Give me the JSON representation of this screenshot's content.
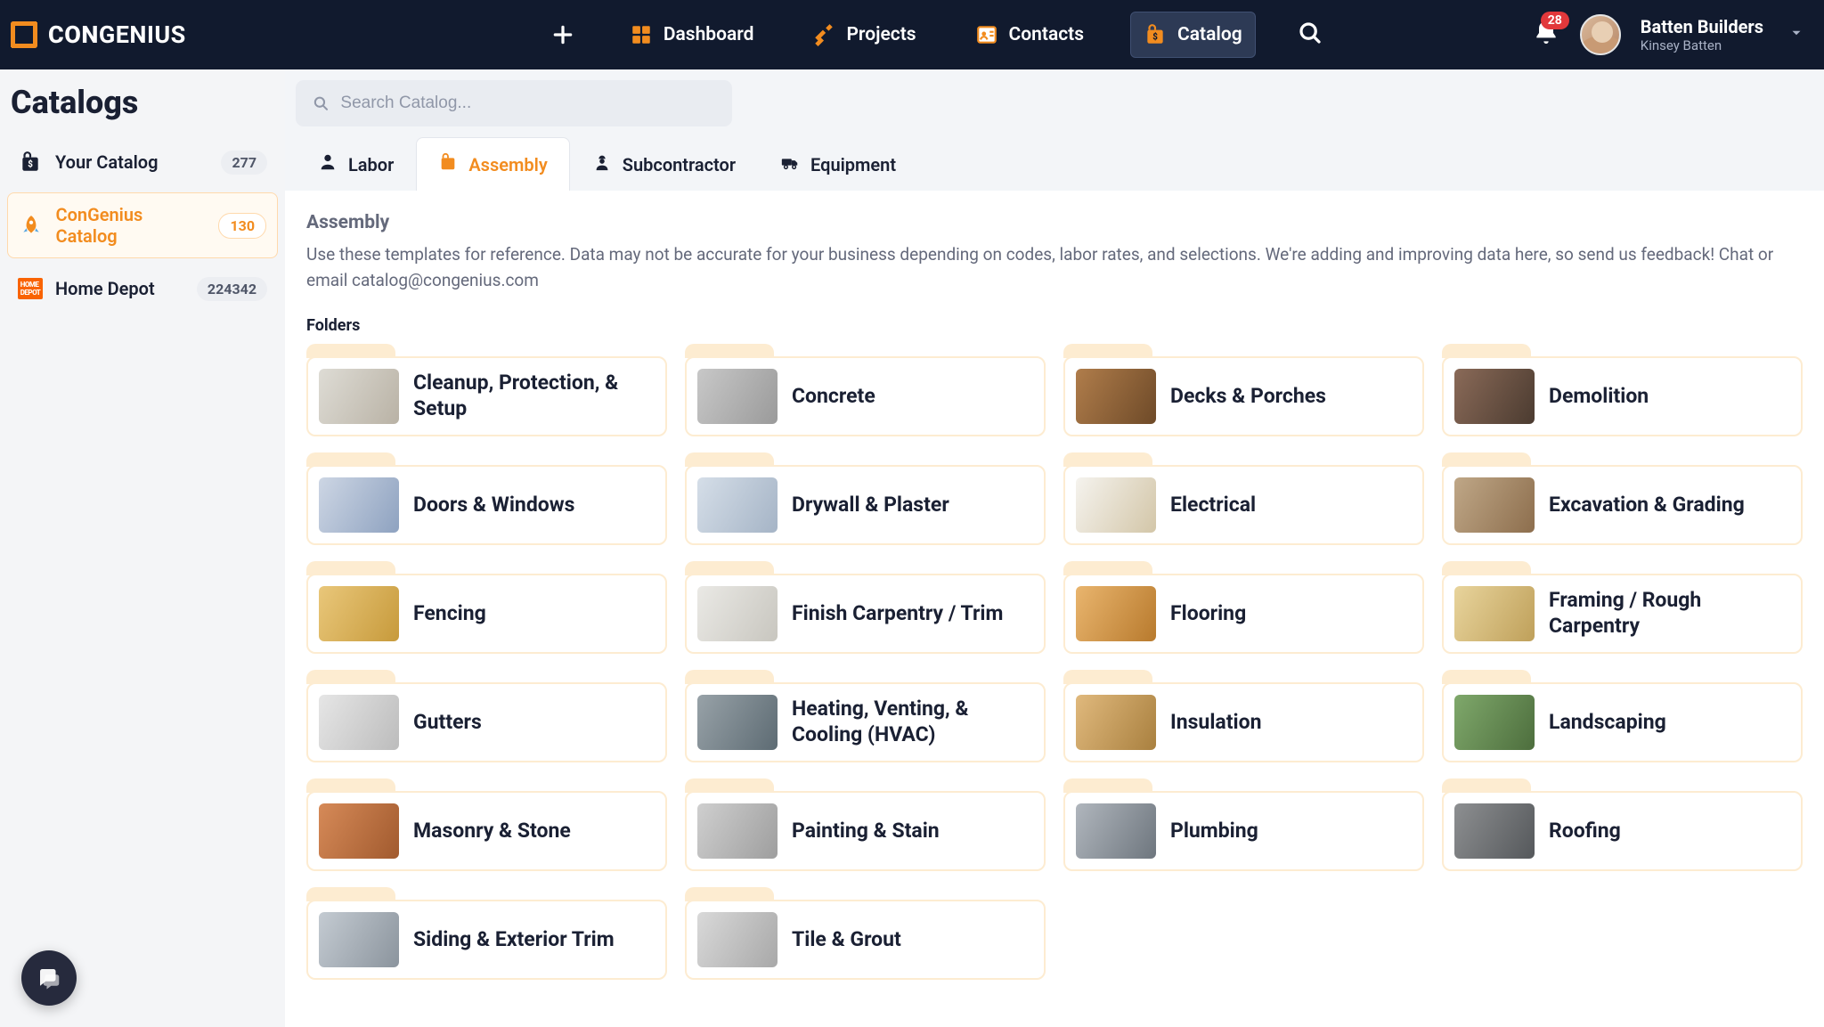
{
  "brand": {
    "name1": "CON",
    "name2": "GENIUS"
  },
  "nav": {
    "dashboard": "Dashboard",
    "projects": "Projects",
    "contacts": "Contacts",
    "catalog": "Catalog"
  },
  "notifications": {
    "count": "28"
  },
  "user": {
    "company": "Batten Builders",
    "name": "Kinsey Batten"
  },
  "sidebar": {
    "title": "Catalogs",
    "items": [
      {
        "label": "Your Catalog",
        "count": "277"
      },
      {
        "label": "ConGenius Catalog",
        "count": "130"
      },
      {
        "label": "Home Depot",
        "count": "224342"
      }
    ]
  },
  "search": {
    "placeholder": "Search Catalog..."
  },
  "tabs": {
    "labor": "Labor",
    "assembly": "Assembly",
    "subcontractor": "Subcontractor",
    "equipment": "Equipment"
  },
  "section": {
    "title": "Assembly",
    "description": "Use these templates for reference. Data may not be accurate for your business depending on codes, labor rates, and selections. We're adding and improving data here, so send us feedback! Chat or email catalog@congenius.com",
    "folders_label": "Folders"
  },
  "folders": [
    {
      "title": "Cleanup, Protection, & Setup"
    },
    {
      "title": "Concrete"
    },
    {
      "title": "Decks & Porches"
    },
    {
      "title": "Demolition"
    },
    {
      "title": "Doors & Windows"
    },
    {
      "title": "Drywall & Plaster"
    },
    {
      "title": "Electrical"
    },
    {
      "title": "Excavation & Grading"
    },
    {
      "title": "Fencing"
    },
    {
      "title": "Finish Carpentry / Trim"
    },
    {
      "title": "Flooring"
    },
    {
      "title": "Framing / Rough Carpentry"
    },
    {
      "title": "Gutters"
    },
    {
      "title": "Heating, Venting, & Cooling (HVAC)"
    },
    {
      "title": "Insulation"
    },
    {
      "title": "Landscaping"
    },
    {
      "title": "Masonry & Stone"
    },
    {
      "title": "Painting & Stain"
    },
    {
      "title": "Plumbing"
    },
    {
      "title": "Roofing"
    },
    {
      "title": "Siding & Exterior Trim"
    },
    {
      "title": "Tile & Grout"
    }
  ]
}
